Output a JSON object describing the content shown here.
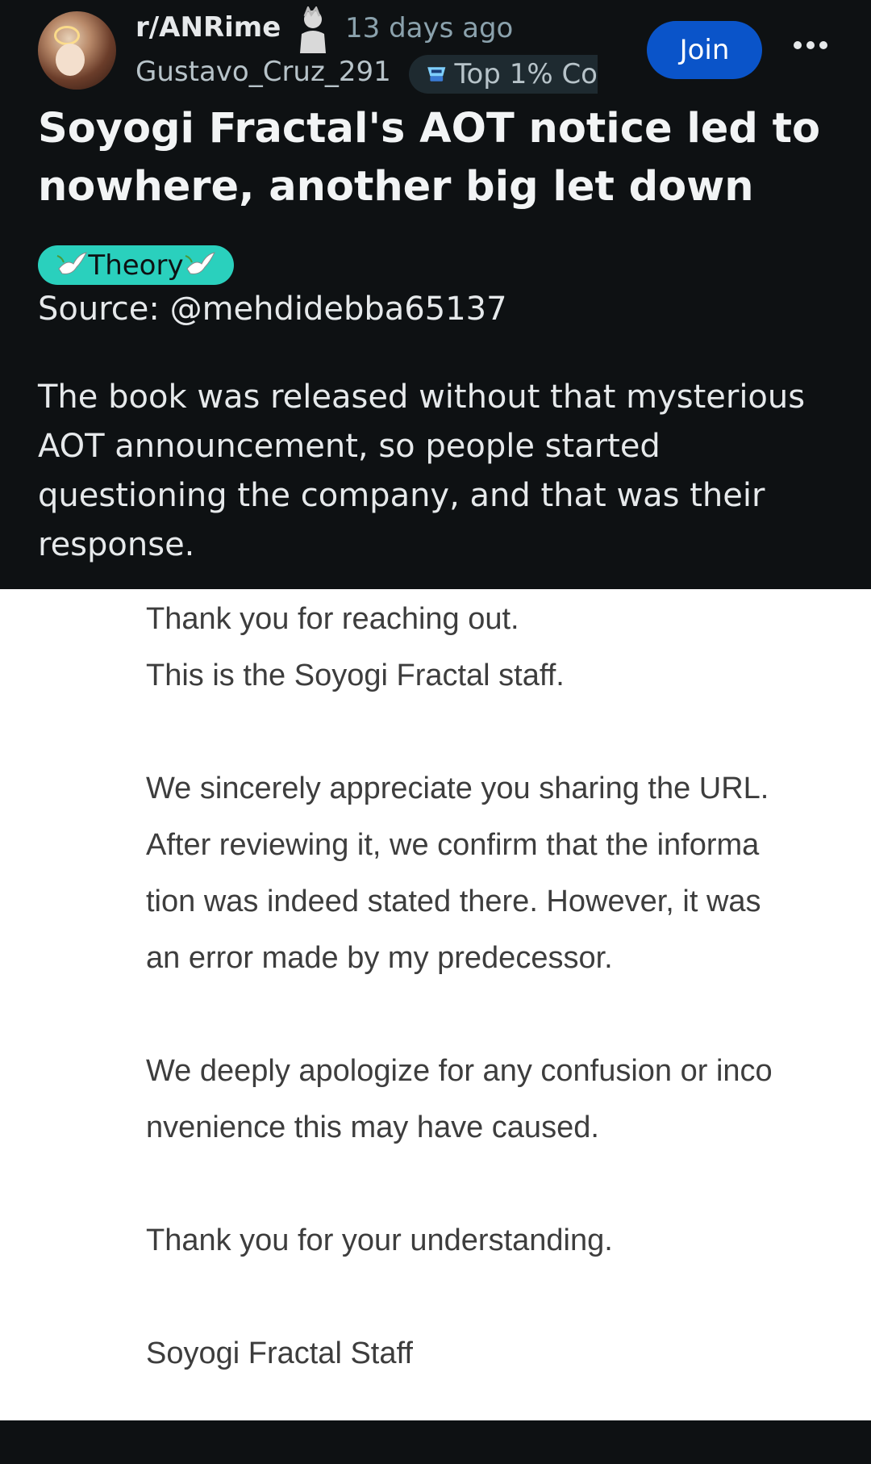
{
  "post": {
    "subreddit": "r/ANRime",
    "time": "13 days ago",
    "username": "Gustavo_Cruz_291",
    "badge": "Top 1% Co",
    "join_label": "Join",
    "title": "Soyogi Fractal's AOT notice led to nowhere, another big let down",
    "flair": "Theory",
    "source": "Source: @mehdidebba65137",
    "body": "The book was released without that mysterious AOT announcement, so people started questioning the company, and that was their response."
  },
  "letter": {
    "line1": "Thank you for reaching out.",
    "line2": "This is the Soyogi Fractal staff.",
    "line3": "We sincerely appreciate you sharing the URL.",
    "line4": "After reviewing it, we confirm that the informa",
    "line5": "tion was indeed stated there. However, it was",
    "line6": "an error made by my predecessor.",
    "line7": "We deeply apologize for any confusion or inco",
    "line8": "nvenience this may have caused.",
    "line9": "Thank you for your understanding.",
    "line10": "Soyogi Fractal Staff"
  },
  "icons": {
    "avatar": "avatar-image",
    "subreddit_flair": "character-flair-icon",
    "badge_icon": "top-contributor-icon",
    "more": "more-options-icon",
    "flair_dove": "dove-icon"
  },
  "colors": {
    "background": "#0e1113",
    "join": "#0a54c9",
    "flair": "#2ad0bd",
    "image_bg": "#ffffff"
  }
}
